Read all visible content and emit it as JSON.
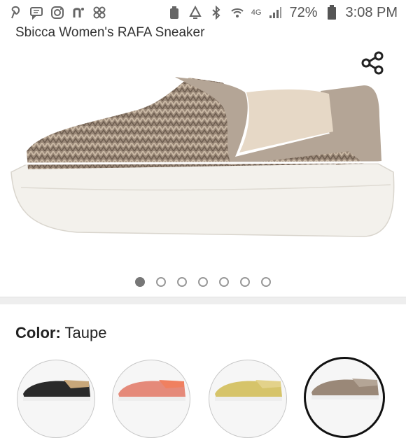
{
  "status_bar": {
    "left_icons": [
      "pinterest-icon",
      "message-icon",
      "instagram-icon",
      "app-n-icon",
      "app-pinwheel-icon"
    ],
    "right_icons": [
      "screenshot-icon",
      "recycle-icon",
      "bluetooth-icon",
      "wifi-icon",
      "signal-icon",
      "battery-icon"
    ],
    "network": "4G",
    "battery_percent": "72%",
    "time": "3:08 PM"
  },
  "product": {
    "title": "Sbicca Women's RAFA Sneaker",
    "colors": {
      "upper_weave": "#9a8878",
      "panel": "#b4a596",
      "sole": "#f3f1ec"
    }
  },
  "carousel": {
    "total": 7,
    "active_index": 0
  },
  "color_selector": {
    "label": "Color:",
    "value": "Taupe",
    "swatches": [
      {
        "name": "black",
        "color": "#2a2a2a",
        "selected": false
      },
      {
        "name": "coral",
        "color": "#e58a7a",
        "selected": false
      },
      {
        "name": "gold",
        "color": "#d6c46a",
        "selected": false
      },
      {
        "name": "taupe",
        "color": "#9a8878",
        "selected": true
      }
    ]
  }
}
